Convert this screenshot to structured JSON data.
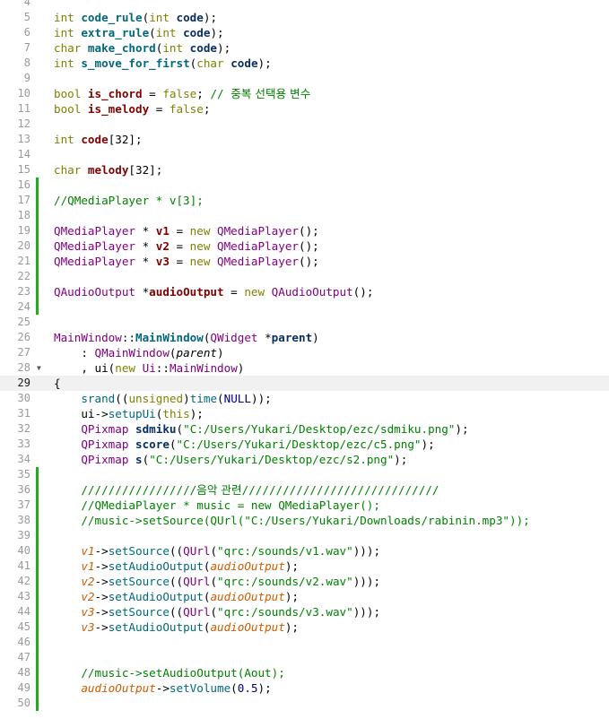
{
  "editor": {
    "current_line": 29,
    "lines": [
      {
        "n": 4,
        "tokens": []
      },
      {
        "n": 5,
        "tokens": [
          {
            "t": "int ",
            "c": "kw"
          },
          {
            "t": "code_rule",
            "c": "fb"
          },
          {
            "t": "(",
            "c": "op"
          },
          {
            "t": "int",
            "c": "kw"
          },
          {
            "t": " code",
            "c": "vb"
          },
          {
            "t": ");",
            "c": "op"
          }
        ]
      },
      {
        "n": 6,
        "tokens": [
          {
            "t": "int ",
            "c": "kw"
          },
          {
            "t": "extra_rule",
            "c": "fb"
          },
          {
            "t": "(",
            "c": "op"
          },
          {
            "t": "int",
            "c": "kw"
          },
          {
            "t": " code",
            "c": "vb"
          },
          {
            "t": ");",
            "c": "op"
          }
        ]
      },
      {
        "n": 7,
        "tokens": [
          {
            "t": "char ",
            "c": "kw"
          },
          {
            "t": "make_chord",
            "c": "fb"
          },
          {
            "t": "(",
            "c": "op"
          },
          {
            "t": "int",
            "c": "kw"
          },
          {
            "t": " code",
            "c": "vb"
          },
          {
            "t": ");",
            "c": "op"
          }
        ]
      },
      {
        "n": 8,
        "tokens": [
          {
            "t": "int ",
            "c": "kw"
          },
          {
            "t": "s_move_for_first",
            "c": "fb"
          },
          {
            "t": "(",
            "c": "op"
          },
          {
            "t": "char",
            "c": "kw"
          },
          {
            "t": " code",
            "c": "vb"
          },
          {
            "t": ");",
            "c": "op"
          }
        ]
      },
      {
        "n": 9,
        "tokens": []
      },
      {
        "n": 10,
        "tokens": [
          {
            "t": "bool ",
            "c": "kw"
          },
          {
            "t": "is_chord",
            "c": "mb"
          },
          {
            "t": " = ",
            "c": "op"
          },
          {
            "t": "false",
            "c": "kw"
          },
          {
            "t": "; ",
            "c": "op"
          },
          {
            "t": "// ",
            "c": "cm"
          },
          {
            "t": "중복 선택용 변수",
            "c": "cm hg"
          }
        ]
      },
      {
        "n": 11,
        "tokens": [
          {
            "t": "bool ",
            "c": "kw"
          },
          {
            "t": "is_melody",
            "c": "mb"
          },
          {
            "t": " = ",
            "c": "op"
          },
          {
            "t": "false",
            "c": "kw"
          },
          {
            "t": ";",
            "c": "op"
          }
        ]
      },
      {
        "n": 12,
        "tokens": []
      },
      {
        "n": 13,
        "tokens": [
          {
            "t": "int ",
            "c": "kw"
          },
          {
            "t": "code",
            "c": "mb"
          },
          {
            "t": "[32];",
            "c": "op"
          }
        ]
      },
      {
        "n": 14,
        "tokens": []
      },
      {
        "n": 15,
        "tokens": [
          {
            "t": "char ",
            "c": "kw"
          },
          {
            "t": "melody",
            "c": "mb"
          },
          {
            "t": "[32];",
            "c": "op"
          }
        ]
      },
      {
        "n": 16,
        "mark": true,
        "tokens": []
      },
      {
        "n": 17,
        "mark": true,
        "tokens": [
          {
            "t": "//QMediaPlayer * v[3];",
            "c": "cm"
          }
        ]
      },
      {
        "n": 18,
        "mark": true,
        "tokens": []
      },
      {
        "n": 19,
        "mark": true,
        "tokens": [
          {
            "t": "QMediaPlayer",
            "c": "ty"
          },
          {
            "t": " * ",
            "c": "op"
          },
          {
            "t": "v1",
            "c": "mb"
          },
          {
            "t": " = ",
            "c": "op"
          },
          {
            "t": "new ",
            "c": "kw"
          },
          {
            "t": "QMediaPlayer",
            "c": "ty"
          },
          {
            "t": "();",
            "c": "op"
          }
        ]
      },
      {
        "n": 20,
        "mark": true,
        "tokens": [
          {
            "t": "QMediaPlayer",
            "c": "ty"
          },
          {
            "t": " * ",
            "c": "op"
          },
          {
            "t": "v2",
            "c": "mb"
          },
          {
            "t": " = ",
            "c": "op"
          },
          {
            "t": "new ",
            "c": "kw"
          },
          {
            "t": "QMediaPlayer",
            "c": "ty"
          },
          {
            "t": "();",
            "c": "op"
          }
        ]
      },
      {
        "n": 21,
        "mark": true,
        "tokens": [
          {
            "t": "QMediaPlayer",
            "c": "ty"
          },
          {
            "t": " * ",
            "c": "op"
          },
          {
            "t": "v3",
            "c": "mb"
          },
          {
            "t": " = ",
            "c": "op"
          },
          {
            "t": "new ",
            "c": "kw"
          },
          {
            "t": "QMediaPlayer",
            "c": "ty"
          },
          {
            "t": "();",
            "c": "op"
          }
        ]
      },
      {
        "n": 22,
        "mark": true,
        "tokens": []
      },
      {
        "n": 23,
        "mark": true,
        "tokens": [
          {
            "t": "QAudioOutput",
            "c": "ty"
          },
          {
            "t": " *",
            "c": "op"
          },
          {
            "t": "audioOutput",
            "c": "mb"
          },
          {
            "t": " = ",
            "c": "op"
          },
          {
            "t": "new ",
            "c": "kw"
          },
          {
            "t": "QAudioOutput",
            "c": "ty"
          },
          {
            "t": "();",
            "c": "op"
          }
        ]
      },
      {
        "n": 24,
        "mark": true,
        "tokens": []
      },
      {
        "n": 25,
        "tokens": []
      },
      {
        "n": 26,
        "tokens": [
          {
            "t": "MainWindow",
            "c": "ty"
          },
          {
            "t": "::",
            "c": "op"
          },
          {
            "t": "MainWindow",
            "c": "fb"
          },
          {
            "t": "(",
            "c": "op"
          },
          {
            "t": "QWidget",
            "c": "ty"
          },
          {
            "t": " *",
            "c": "op"
          },
          {
            "t": "parent",
            "c": "vb"
          },
          {
            "t": ")",
            "c": "op"
          }
        ]
      },
      {
        "n": 27,
        "tokens": [
          {
            "t": "    : ",
            "c": "op"
          },
          {
            "t": "QMainWindow",
            "c": "ty"
          },
          {
            "t": "(",
            "c": "op"
          },
          {
            "t": "parent",
            "c": "pa"
          },
          {
            "t": ")",
            "c": "op"
          }
        ]
      },
      {
        "n": 28,
        "fold": true,
        "tokens": [
          {
            "t": "    , ",
            "c": "op"
          },
          {
            "t": "ui",
            "c": "op"
          },
          {
            "t": "(",
            "c": "op"
          },
          {
            "t": "new ",
            "c": "kw"
          },
          {
            "t": "Ui",
            "c": "ty"
          },
          {
            "t": "::",
            "c": "op"
          },
          {
            "t": "MainWindow",
            "c": "ty"
          },
          {
            "t": ")",
            "c": "op"
          }
        ]
      },
      {
        "n": 29,
        "tokens": [
          {
            "t": "{",
            "c": "op"
          }
        ]
      },
      {
        "n": 30,
        "tokens": [
          {
            "t": "    ",
            "c": "op"
          },
          {
            "t": "srand",
            "c": "fn"
          },
          {
            "t": "((",
            "c": "op"
          },
          {
            "t": "unsigned",
            "c": "kw"
          },
          {
            "t": ")",
            "c": "op"
          },
          {
            "t": "time",
            "c": "fn"
          },
          {
            "t": "(",
            "c": "op"
          },
          {
            "t": "NULL",
            "c": "pr"
          },
          {
            "t": "));",
            "c": "op"
          }
        ]
      },
      {
        "n": 31,
        "tokens": [
          {
            "t": "    ",
            "c": "op"
          },
          {
            "t": "ui",
            "c": "op"
          },
          {
            "t": "->",
            "c": "op"
          },
          {
            "t": "setupUi",
            "c": "fn"
          },
          {
            "t": "(",
            "c": "op"
          },
          {
            "t": "this",
            "c": "kw"
          },
          {
            "t": ");",
            "c": "op"
          }
        ]
      },
      {
        "n": 32,
        "tokens": [
          {
            "t": "    ",
            "c": "op"
          },
          {
            "t": "QPixmap",
            "c": "ty"
          },
          {
            "t": " ",
            "c": "op"
          },
          {
            "t": "sdmiku",
            "c": "vb"
          },
          {
            "t": "(",
            "c": "op"
          },
          {
            "t": "\"C:/Users/Yukari/Desktop/ezc/sdmiku.png\"",
            "c": "st"
          },
          {
            "t": ");",
            "c": "op"
          }
        ]
      },
      {
        "n": 33,
        "tokens": [
          {
            "t": "    ",
            "c": "op"
          },
          {
            "t": "QPixmap",
            "c": "ty"
          },
          {
            "t": " ",
            "c": "op"
          },
          {
            "t": "score",
            "c": "vb"
          },
          {
            "t": "(",
            "c": "op"
          },
          {
            "t": "\"C:/Users/Yukari/Desktop/ezc/c5.png\"",
            "c": "st"
          },
          {
            "t": ");",
            "c": "op"
          }
        ]
      },
      {
        "n": 34,
        "tokens": [
          {
            "t": "    ",
            "c": "op"
          },
          {
            "t": "QPixmap",
            "c": "ty"
          },
          {
            "t": " ",
            "c": "op"
          },
          {
            "t": "s",
            "c": "vb"
          },
          {
            "t": "(",
            "c": "op"
          },
          {
            "t": "\"C:/Users/Yukari/Desktop/ezc/s2.png\"",
            "c": "st"
          },
          {
            "t": ");",
            "c": "op"
          }
        ]
      },
      {
        "n": 35,
        "mark": true,
        "tokens": []
      },
      {
        "n": 36,
        "mark": true,
        "tokens": [
          {
            "t": "    ",
            "c": "op"
          },
          {
            "t": "/////////////////",
            "c": "cm"
          },
          {
            "t": "음악 관련",
            "c": "cm hg"
          },
          {
            "t": "/////////////////////////////",
            "c": "cm"
          }
        ]
      },
      {
        "n": 37,
        "mark": true,
        "tokens": [
          {
            "t": "    ",
            "c": "op"
          },
          {
            "t": "//QMediaPlayer * music = new QMediaPlayer();",
            "c": "cm"
          }
        ]
      },
      {
        "n": 38,
        "mark": true,
        "tokens": [
          {
            "t": "    ",
            "c": "op"
          },
          {
            "t": "//music->setSource(QUrl(\"C:/Users/Yukari/Downloads/rabinin.mp3\"));",
            "c": "cm"
          }
        ]
      },
      {
        "n": 39,
        "mark": true,
        "tokens": []
      },
      {
        "n": 40,
        "mark": true,
        "tokens": [
          {
            "t": "    ",
            "c": "op"
          },
          {
            "t": "v1",
            "c": "mi"
          },
          {
            "t": "->",
            "c": "op"
          },
          {
            "t": "setSource",
            "c": "fn"
          },
          {
            "t": "((",
            "c": "op"
          },
          {
            "t": "QUrl",
            "c": "ty"
          },
          {
            "t": "(",
            "c": "op"
          },
          {
            "t": "\"qrc:/sounds/v1.wav\"",
            "c": "st"
          },
          {
            "t": ")));",
            "c": "op"
          }
        ]
      },
      {
        "n": 41,
        "mark": true,
        "tokens": [
          {
            "t": "    ",
            "c": "op"
          },
          {
            "t": "v1",
            "c": "mi"
          },
          {
            "t": "->",
            "c": "op"
          },
          {
            "t": "setAudioOutput",
            "c": "fn"
          },
          {
            "t": "(",
            "c": "op"
          },
          {
            "t": "audioOutput",
            "c": "mi"
          },
          {
            "t": ");",
            "c": "op"
          }
        ]
      },
      {
        "n": 42,
        "mark": true,
        "tokens": [
          {
            "t": "    ",
            "c": "op"
          },
          {
            "t": "v2",
            "c": "mi"
          },
          {
            "t": "->",
            "c": "op"
          },
          {
            "t": "setSource",
            "c": "fn"
          },
          {
            "t": "((",
            "c": "op"
          },
          {
            "t": "QUrl",
            "c": "ty"
          },
          {
            "t": "(",
            "c": "op"
          },
          {
            "t": "\"qrc:/sounds/v2.wav\"",
            "c": "st"
          },
          {
            "t": ")));",
            "c": "op"
          }
        ]
      },
      {
        "n": 43,
        "mark": true,
        "tokens": [
          {
            "t": "    ",
            "c": "op"
          },
          {
            "t": "v2",
            "c": "mi"
          },
          {
            "t": "->",
            "c": "op"
          },
          {
            "t": "setAudioOutput",
            "c": "fn"
          },
          {
            "t": "(",
            "c": "op"
          },
          {
            "t": "audioOutput",
            "c": "mi"
          },
          {
            "t": ");",
            "c": "op"
          }
        ]
      },
      {
        "n": 44,
        "mark": true,
        "tokens": [
          {
            "t": "    ",
            "c": "op"
          },
          {
            "t": "v3",
            "c": "mi"
          },
          {
            "t": "->",
            "c": "op"
          },
          {
            "t": "setSource",
            "c": "fn"
          },
          {
            "t": "((",
            "c": "op"
          },
          {
            "t": "QUrl",
            "c": "ty"
          },
          {
            "t": "(",
            "c": "op"
          },
          {
            "t": "\"qrc:/sounds/v3.wav\"",
            "c": "st"
          },
          {
            "t": ")));",
            "c": "op"
          }
        ]
      },
      {
        "n": 45,
        "mark": true,
        "tokens": [
          {
            "t": "    ",
            "c": "op"
          },
          {
            "t": "v3",
            "c": "mi"
          },
          {
            "t": "->",
            "c": "op"
          },
          {
            "t": "setAudioOutput",
            "c": "fn"
          },
          {
            "t": "(",
            "c": "op"
          },
          {
            "t": "audioOutput",
            "c": "mi"
          },
          {
            "t": ");",
            "c": "op"
          }
        ]
      },
      {
        "n": 46,
        "mark": true,
        "tokens": []
      },
      {
        "n": 47,
        "mark": true,
        "tokens": []
      },
      {
        "n": 48,
        "mark": true,
        "tokens": [
          {
            "t": "    ",
            "c": "op"
          },
          {
            "t": "//music->setAudioOutput(Aout);",
            "c": "cm"
          }
        ]
      },
      {
        "n": 49,
        "mark": true,
        "tokens": [
          {
            "t": "    ",
            "c": "op"
          },
          {
            "t": "audioOutput",
            "c": "mi"
          },
          {
            "t": "->",
            "c": "op"
          },
          {
            "t": "setVolume",
            "c": "fn"
          },
          {
            "t": "(",
            "c": "op"
          },
          {
            "t": "0.5",
            "c": "nm"
          },
          {
            "t": ");",
            "c": "op"
          }
        ]
      },
      {
        "n": 50,
        "mark": true,
        "tokens": []
      }
    ]
  }
}
